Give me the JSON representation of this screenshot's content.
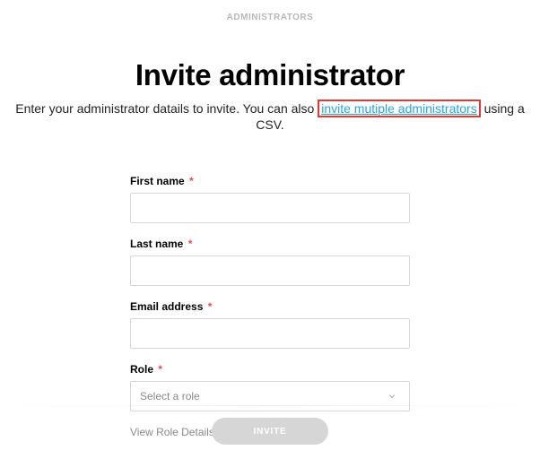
{
  "breadcrumb": "ADMINISTRATORS",
  "header": {
    "title": "Invite administrator",
    "desc_before": "Enter your administrator datails to invite. You can also ",
    "link_text": "invite mutiple administrators",
    "desc_after": " using a CSV."
  },
  "form": {
    "first_name": {
      "label": "First name",
      "value": ""
    },
    "last_name": {
      "label": "Last name",
      "value": ""
    },
    "email": {
      "label": "Email address",
      "value": ""
    },
    "role": {
      "label": "Role",
      "placeholder": "Select a role"
    },
    "view_role_details": "View Role Details"
  },
  "footer": {
    "invite_button": "INVITE"
  },
  "marks": {
    "required": "*"
  }
}
